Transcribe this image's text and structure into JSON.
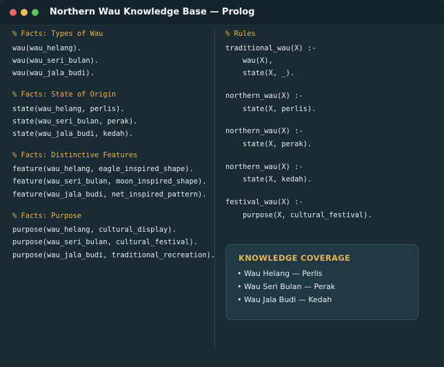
{
  "window": {
    "title": "Northern Wau Knowledge Base — Prolog"
  },
  "facts": {
    "types_comment": "% Facts: Types of Wau",
    "types": [
      "wau(wau_helang).",
      "wau(wau_seri_bulan).",
      "wau(wau_jala_budi)."
    ],
    "origin_comment": "% Facts: State of Origin",
    "origin": [
      "state(wau_helang, perlis).",
      "state(wau_seri_bulan, perak).",
      "state(wau_jala_budi, kedah)."
    ],
    "features_comment": "% Facts: Distinctive Features",
    "features": [
      "feature(wau_helang, eagle_inspired_shape).",
      "feature(wau_seri_bulan, moon_inspired_shape).",
      "feature(wau_jala_budi, net_inspired_pattern)."
    ],
    "purpose_comment": "% Facts: Purpose",
    "purpose": [
      "purpose(wau_helang, cultural_display).",
      "purpose(wau_seri_bulan, cultural_festival).",
      "purpose(wau_jala_budi, traditional_recreation)."
    ]
  },
  "rules": {
    "comment": "% Rules",
    "traditional": [
      "traditional_wau(X) :-",
      "    wau(X),",
      "    state(X, _)."
    ],
    "northern_perlis": [
      "northern_wau(X) :-",
      "    state(X, perlis)."
    ],
    "northern_perak": [
      "northern_wau(X) :-",
      "    state(X, perak)."
    ],
    "northern_kedah": [
      "northern_wau(X) :-",
      "    state(X, kedah)."
    ],
    "festival": [
      "festival_wau(X) :-",
      "    purpose(X, cultural_festival)."
    ]
  },
  "coverage": {
    "title": "KNOWLEDGE COVERAGE",
    "items": [
      "• Wau Helang — Perlis",
      "• Wau Seri Bulan — Perak",
      "• Wau Jala Budi — Kedah"
    ]
  }
}
